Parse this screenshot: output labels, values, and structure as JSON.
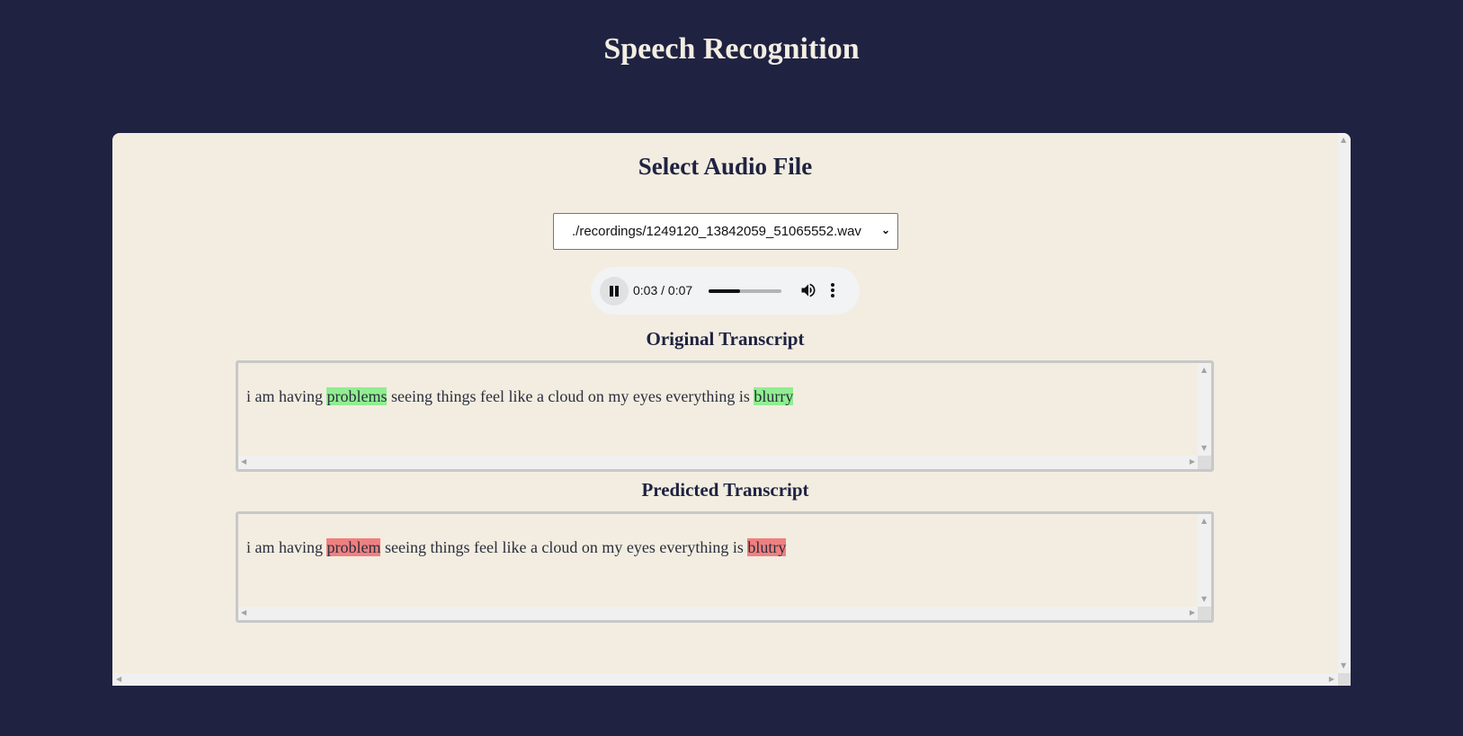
{
  "header": {
    "title": "Speech Recognition"
  },
  "panel": {
    "select_heading": "Select Audio File",
    "audio_select": {
      "selected": "./recordings/1249120_13842059_51065552.wav"
    },
    "player": {
      "current_time": "0:03",
      "duration": "0:07",
      "time_display": "0:03 / 0:07",
      "progress_fraction": 0.43,
      "state": "playing"
    },
    "original": {
      "heading": "Original Transcript",
      "segments": [
        {
          "text": "i am having ",
          "highlight": "none"
        },
        {
          "text": "problems",
          "highlight": "green"
        },
        {
          "text": " seeing things feel like a cloud on my eyes everything is ",
          "highlight": "none"
        },
        {
          "text": "blurry",
          "highlight": "green"
        }
      ]
    },
    "predicted": {
      "heading": "Predicted Transcript",
      "segments": [
        {
          "text": "i am having ",
          "highlight": "none"
        },
        {
          "text": "problem",
          "highlight": "red"
        },
        {
          "text": " seeing things feel like a cloud on my eyes everything is ",
          "highlight": "none"
        },
        {
          "text": "blutry",
          "highlight": "red"
        }
      ]
    }
  },
  "colors": {
    "background": "#1f2241",
    "panel": "#f2ede0",
    "match_highlight": "#90ee90",
    "error_highlight": "#f08080"
  },
  "icons": [
    "pause-icon",
    "volume-icon",
    "more-options-icon",
    "chevron-down-icon"
  ]
}
